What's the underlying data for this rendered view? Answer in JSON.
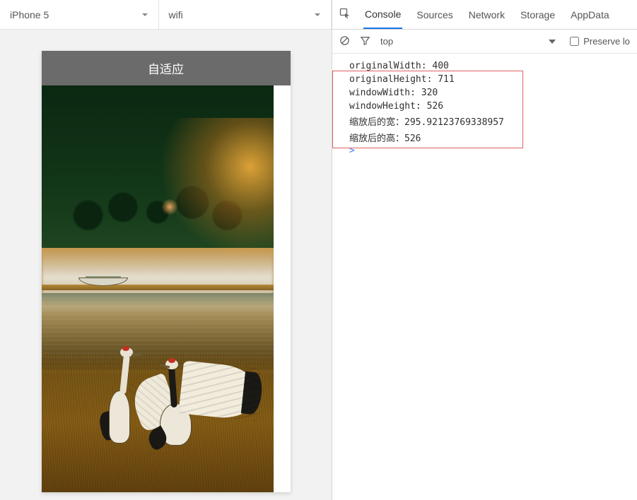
{
  "deviceBar": {
    "device": "iPhone 5",
    "network": "wifi"
  },
  "app": {
    "title": "自适应"
  },
  "devtools": {
    "tabs": {
      "console": "Console",
      "sources": "Sources",
      "network": "Network",
      "storage": "Storage",
      "appdata": "AppData"
    },
    "activeTab": "console",
    "filter": {
      "context": "top",
      "preserveLabel": "Preserve lo"
    },
    "logs": [
      {
        "key": "originalWidth",
        "value": "400"
      },
      {
        "key": "originalHeight",
        "value": "711"
      },
      {
        "key": "windowWidth",
        "value": "320"
      },
      {
        "key": "windowHeight",
        "value": "526"
      },
      {
        "key": "缩放后的宽",
        "value": "295.92123769338957"
      },
      {
        "key": "缩放后的高",
        "value": "526"
      }
    ],
    "promptSymbol": ">"
  }
}
